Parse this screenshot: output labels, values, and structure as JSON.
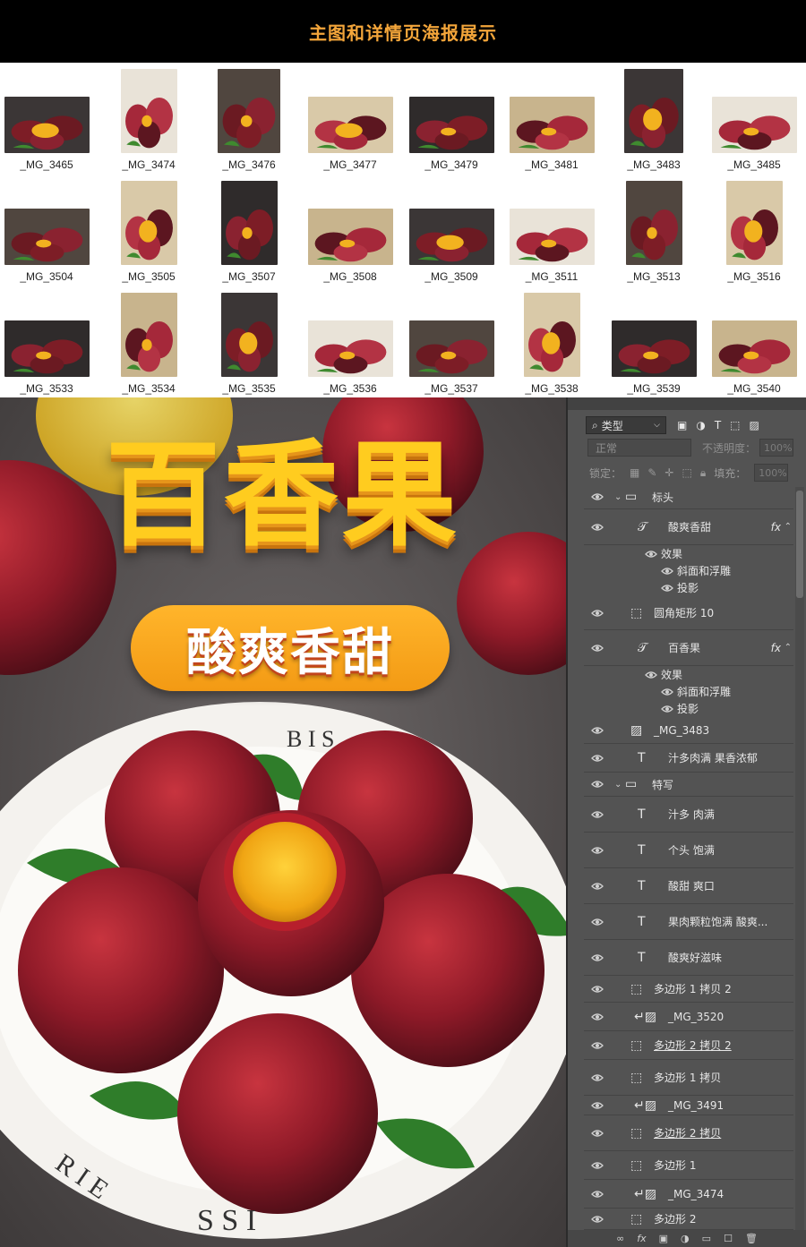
{
  "header": {
    "title": "主图和详情页海报展示"
  },
  "thumbnails": [
    {
      "label": "_MG_3465"
    },
    {
      "label": "_MG_3474"
    },
    {
      "label": "_MG_3476"
    },
    {
      "label": "_MG_3477"
    },
    {
      "label": "_MG_3479"
    },
    {
      "label": "_MG_3481"
    },
    {
      "label": "_MG_3483"
    },
    {
      "label": "_MG_3485"
    },
    {
      "label": "_MG_3504"
    },
    {
      "label": "_MG_3505"
    },
    {
      "label": "_MG_3507"
    },
    {
      "label": "_MG_3508"
    },
    {
      "label": "_MG_3509"
    },
    {
      "label": "_MG_3511"
    },
    {
      "label": "_MG_3513"
    },
    {
      "label": "_MG_3516"
    },
    {
      "label": "_MG_3533"
    },
    {
      "label": "_MG_3534"
    },
    {
      "label": "_MG_3535"
    },
    {
      "label": "_MG_3536"
    },
    {
      "label": "_MG_3537"
    },
    {
      "label": "_MG_3538"
    },
    {
      "label": "_MG_3539"
    },
    {
      "label": "_MG_3540"
    }
  ],
  "poster": {
    "title": "百香果",
    "subtitle": "酸爽香甜"
  },
  "panel": {
    "filter_kind": "类型",
    "blend_mode": "正常",
    "opacity_label": "不透明度：",
    "opacity_value": "100%",
    "lock_label": "锁定：",
    "fill_label": "填充：",
    "fill_value": "100%",
    "layers": [
      {
        "name": "标头"
      },
      {
        "name": "酸爽香甜"
      },
      {
        "name": "效果"
      },
      {
        "name": "斜面和浮雕"
      },
      {
        "name": "投影"
      },
      {
        "name": "圆角矩形 10"
      },
      {
        "name": "百香果"
      },
      {
        "name": "效果"
      },
      {
        "name": "斜面和浮雕"
      },
      {
        "name": "投影"
      },
      {
        "name": "_MG_3483"
      },
      {
        "name": "汁多肉满 果香浓郁"
      },
      {
        "name": "特写"
      },
      {
        "name": "汁多 肉满"
      },
      {
        "name": "个头 饱满"
      },
      {
        "name": "酸甜 爽口"
      },
      {
        "name": "果肉颗粒饱满 酸爽..."
      },
      {
        "name": "酸爽好滋味"
      },
      {
        "name": "多边形 1 拷贝 2"
      },
      {
        "name": "_MG_3520"
      },
      {
        "name": "多边形 2 拷贝 2"
      },
      {
        "name": "多边形 1 拷贝"
      },
      {
        "name": "_MG_3491"
      },
      {
        "name": "多边形 2 拷贝"
      },
      {
        "name": "多边形 1"
      },
      {
        "name": "_MG_3474"
      },
      {
        "name": "多边形 2"
      }
    ]
  }
}
